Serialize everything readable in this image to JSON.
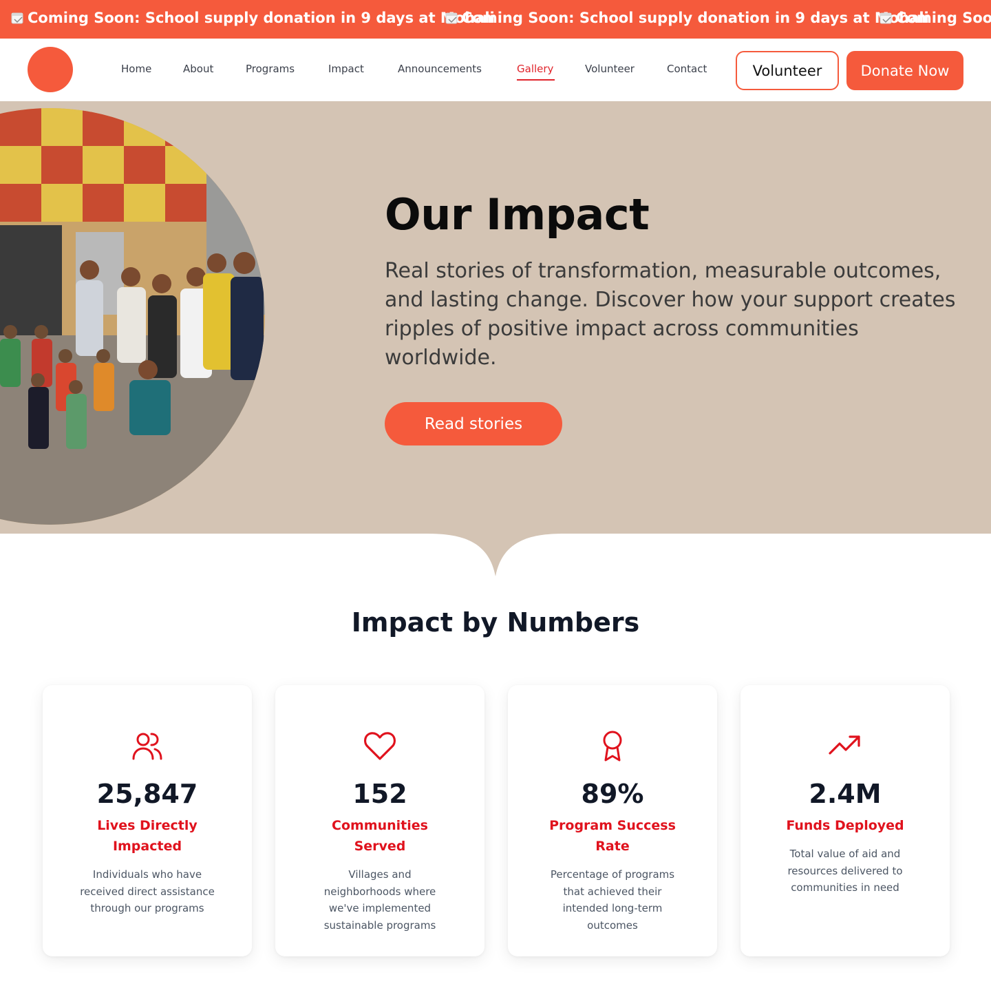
{
  "ticker": {
    "items": [
      "Coming Soon: School supply donation in 9 days at Mohali",
      "Coming Soon: School supply donation in 9 days at Mohali",
      "Coming Soon:"
    ],
    "icon": "calendar-icon"
  },
  "nav": {
    "items": [
      "Home",
      "About",
      "Programs",
      "Impact",
      "Announcements",
      "Gallery",
      "Volunteer",
      "Contact"
    ],
    "active": "Gallery",
    "volunteer_button": "Volunteer",
    "donate_button": "Donate Now"
  },
  "hero": {
    "title": "Our Impact",
    "subtitle": "Real stories of transformation, measurable outcomes, and lasting change. Discover how your support creates ripples of positive impact across communities worldwide.",
    "cta": "Read stories"
  },
  "numbers": {
    "title": "Impact by Numbers",
    "cards": [
      {
        "icon": "users-icon",
        "value": "25,847",
        "label": "Lives Directly Impacted",
        "description": "Individuals who have received direct assistance through our programs"
      },
      {
        "icon": "heart-icon",
        "value": "152",
        "label": "Communities Served",
        "description": "Villages and neighborhoods where we've implemented sustainable programs"
      },
      {
        "icon": "award-icon",
        "value": "89%",
        "label": "Program Success Rate",
        "description": "Percentage of programs that achieved their intended long-term outcomes"
      },
      {
        "icon": "trending-up-icon",
        "value": "2.4M",
        "label": "Funds Deployed",
        "description": "Total value of aid and resources delivered to communities in need"
      }
    ]
  },
  "colors": {
    "accent": "#f55a3c",
    "hero_bg": "#d4c4b4",
    "highlight_red": "#e0121d"
  }
}
